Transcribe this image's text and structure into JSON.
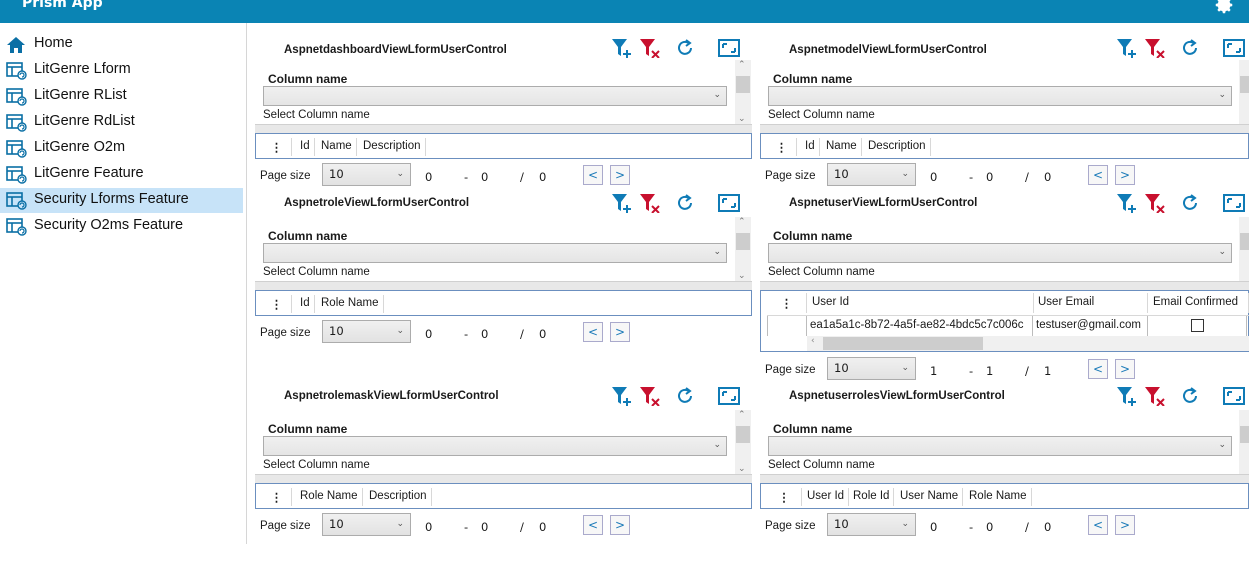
{
  "app": {
    "title": "Prism App"
  },
  "sidebar": {
    "items": [
      {
        "label": "Home",
        "icon": "home-icon",
        "active": false
      },
      {
        "label": "LitGenre Lform",
        "icon": "form-icon",
        "active": false
      },
      {
        "label": "LitGenre RList",
        "icon": "form-icon",
        "active": false
      },
      {
        "label": "LitGenre RdList",
        "icon": "form-icon",
        "active": false
      },
      {
        "label": "LitGenre O2m",
        "icon": "form-icon",
        "active": false
      },
      {
        "label": "LitGenre Feature",
        "icon": "form-icon",
        "active": false
      },
      {
        "label": "Security Lforms Feature",
        "icon": "form-icon",
        "active": true
      },
      {
        "label": "Security O2ms Feature",
        "icon": "form-icon",
        "active": false
      }
    ]
  },
  "common": {
    "column_name_label": "Column name",
    "select_hint": "Select Column name",
    "page_size_label": "Page size",
    "page_size_value": "10",
    "range_dash": "-",
    "range_slash": "/",
    "prev_glyph": "<",
    "next_glyph": ">",
    "menu_glyph": "⋮"
  },
  "colors": {
    "accent": "#0a84b4",
    "filter_add": "#0f7bb6",
    "filter_clear": "#c8102e",
    "active_nav": "#c7e3f8"
  },
  "panels": [
    {
      "title": "AspnetdashboardViewLformUserControl",
      "columns": [
        "Id",
        "Name",
        "Description"
      ],
      "from": "0",
      "to": "0",
      "total": "0"
    },
    {
      "title": "AspnetmodelViewLformUserControl",
      "columns": [
        "Id",
        "Name",
        "Description"
      ],
      "from": "0",
      "to": "0",
      "total": "0"
    },
    {
      "title": "AspnetroleViewLformUserControl",
      "columns": [
        "Id",
        "Role Name"
      ],
      "from": "0",
      "to": "0",
      "total": "0"
    },
    {
      "title": "AspnetuserViewLformUserControl",
      "columns": [
        "User Id",
        "User Email",
        "Email Confirmed"
      ],
      "rows": [
        {
          "user_id": "ea1a5a1c-8b72-4a5f-ae82-4bdc5c7c006c",
          "user_email": "testuser@gmail.com",
          "email_confirmed": false
        }
      ],
      "from": "1",
      "to": "1",
      "total": "1"
    },
    {
      "title": "AspnetrolemaskViewLformUserControl",
      "columns": [
        "Role Name",
        "Description"
      ],
      "from": "0",
      "to": "0",
      "total": "0"
    },
    {
      "title": "AspnetuserrolesViewLformUserControl",
      "columns": [
        "User Id",
        "Role Id",
        "User Name",
        "Role Name"
      ],
      "from": "0",
      "to": "0",
      "total": "0"
    }
  ]
}
